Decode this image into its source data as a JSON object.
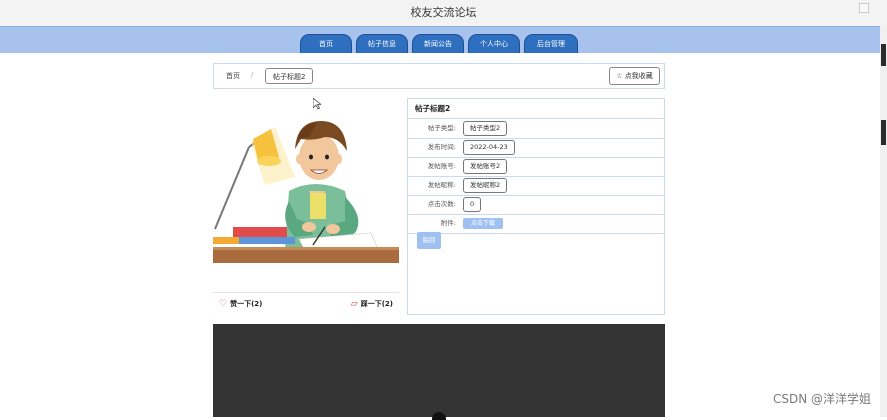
{
  "header": {
    "site_title": "校友交流论坛"
  },
  "nav": {
    "tabs": [
      {
        "label": "首页"
      },
      {
        "label": "帖子信息"
      },
      {
        "label": "新闻公告"
      },
      {
        "label": "个人中心"
      },
      {
        "label": "后台管理"
      }
    ]
  },
  "breadcrumb": {
    "home": "首页",
    "separator": "/",
    "current": "帖子标题2",
    "favorite_label": "☆ 点我收藏"
  },
  "vote": {
    "like_label": "赞一下(2)",
    "dislike_label": "踩一下(2)"
  },
  "detail": {
    "title": "帖子标题2",
    "fields": [
      {
        "label": "帖子类型:",
        "value": "帖子类型2"
      },
      {
        "label": "发布时间:",
        "value": "2022-04-23"
      },
      {
        "label": "发帖账号:",
        "value": "发帖账号2"
      },
      {
        "label": "发帖昵称:",
        "value": "发帖昵称2"
      },
      {
        "label": "点击次数:",
        "value": "0"
      }
    ],
    "attachment_label": "附件:",
    "download_label": "点击下载",
    "reply_label": "贴回"
  },
  "watermark": "CSDN @洋洋学姐",
  "colors": {
    "nav_bg": "#a8c2ee",
    "tab_bg": "#2f6fbf",
    "button_light": "#9fc1f2",
    "video_bg": "#333333"
  },
  "icons": {
    "like": "thumbs-up-icon",
    "dislike": "thumbs-down-icon",
    "favorite": "star-icon"
  }
}
